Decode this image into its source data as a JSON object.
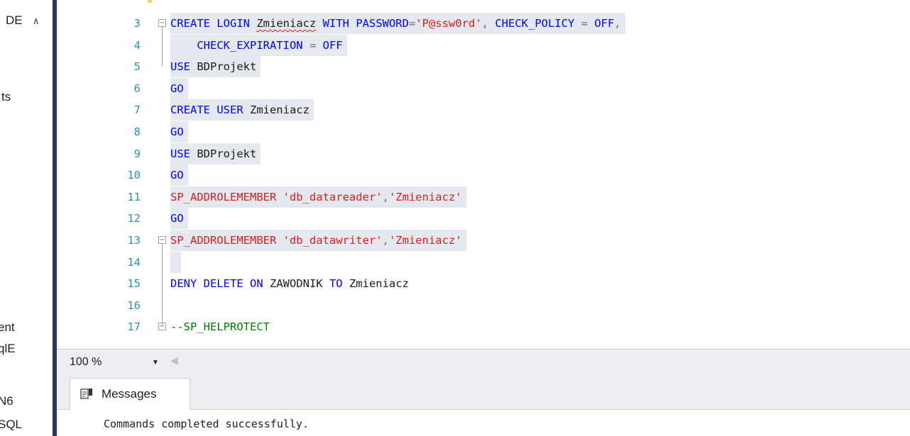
{
  "left_panel": {
    "fragments": [
      "DE",
      "ts",
      "ent",
      "qlE",
      "N6",
      "SQL"
    ]
  },
  "editor": {
    "lines": [
      {
        "n": "3",
        "fold": "minus",
        "tokens": [
          {
            "t": "CREATE LOGIN ",
            "c": "kw"
          },
          {
            "t": "Zmieniacz",
            "c": "id",
            "sq": true
          },
          {
            "t": " WITH PASSWORD",
            "c": "kw"
          },
          {
            "t": "=",
            "c": "op"
          },
          {
            "t": "'P@ssw0rd'",
            "c": "str"
          },
          {
            "t": ", ",
            "c": "op"
          },
          {
            "t": "CHECK_POLICY",
            "c": "kw"
          },
          {
            "t": " = ",
            "c": "op"
          },
          {
            "t": "OFF",
            "c": "kw"
          },
          {
            "t": ",",
            "c": "op"
          }
        ]
      },
      {
        "n": "4",
        "tokens": [
          {
            "t": "    CHECK_EXPIRATION",
            "c": "kw"
          },
          {
            "t": " = ",
            "c": "op"
          },
          {
            "t": "OFF",
            "c": "kw"
          }
        ]
      },
      {
        "n": "5",
        "tokens": [
          {
            "t": "USE ",
            "c": "kw"
          },
          {
            "t": "BDProjekt",
            "c": "id"
          }
        ]
      },
      {
        "n": "6",
        "tokens": [
          {
            "t": "GO",
            "c": "kw"
          }
        ]
      },
      {
        "n": "7",
        "tokens": [
          {
            "t": "CREATE USER ",
            "c": "kw"
          },
          {
            "t": "Zmieniacz",
            "c": "id"
          }
        ]
      },
      {
        "n": "8",
        "tokens": [
          {
            "t": "GO",
            "c": "kw"
          }
        ]
      },
      {
        "n": "9",
        "tokens": [
          {
            "t": "USE ",
            "c": "kw"
          },
          {
            "t": "BDProjekt",
            "c": "id"
          }
        ]
      },
      {
        "n": "10",
        "tokens": [
          {
            "t": "GO",
            "c": "kw"
          }
        ]
      },
      {
        "n": "11",
        "tokens": [
          {
            "t": "SP_ADDROLEMEMBER ",
            "c": "str"
          },
          {
            "t": "'db_datareader'",
            "c": "str"
          },
          {
            "t": ",",
            "c": "op"
          },
          {
            "t": "'Zmieniacz'",
            "c": "str"
          }
        ]
      },
      {
        "n": "12",
        "tokens": [
          {
            "t": "GO",
            "c": "kw"
          }
        ]
      },
      {
        "n": "13",
        "fold": "minus",
        "tokens": [
          {
            "t": "SP_ADDROLEMEMBER ",
            "c": "str"
          },
          {
            "t": "'db_datawriter'",
            "c": "str"
          },
          {
            "t": ",",
            "c": "op"
          },
          {
            "t": "'Zmieniacz'",
            "c": "str"
          }
        ]
      },
      {
        "n": "14",
        "tokens": [
          {
            "t": " ",
            "c": "id"
          }
        ]
      },
      {
        "n": "15",
        "plain": true,
        "tokens": [
          {
            "t": "DENY DELETE ON ",
            "c": "kw"
          },
          {
            "t": "ZAWODNIK",
            "c": "id"
          },
          {
            "t": " TO ",
            "c": "kw"
          },
          {
            "t": "Zmieniacz",
            "c": "id"
          }
        ]
      },
      {
        "n": "16",
        "plain": true,
        "tokens": []
      },
      {
        "n": "17",
        "fold": "minus",
        "plain": true,
        "tokens": [
          {
            "t": "--SP_HELPROTECT",
            "c": "cm"
          }
        ]
      }
    ]
  },
  "statusbar": {
    "zoom_value": "100 %"
  },
  "results": {
    "tab_label": "Messages",
    "message": "Commands completed successfully."
  },
  "colors": {
    "keyword": "#0000ff",
    "string": "#e01b1b",
    "comment": "#008000",
    "line_number": "#2b91af",
    "selection": "#e4e8ef",
    "divider": "#293955"
  },
  "icons": [
    "chevron-up-icon",
    "fold-minus-icon",
    "dropdown-arrow-icon",
    "messages-icon"
  ]
}
